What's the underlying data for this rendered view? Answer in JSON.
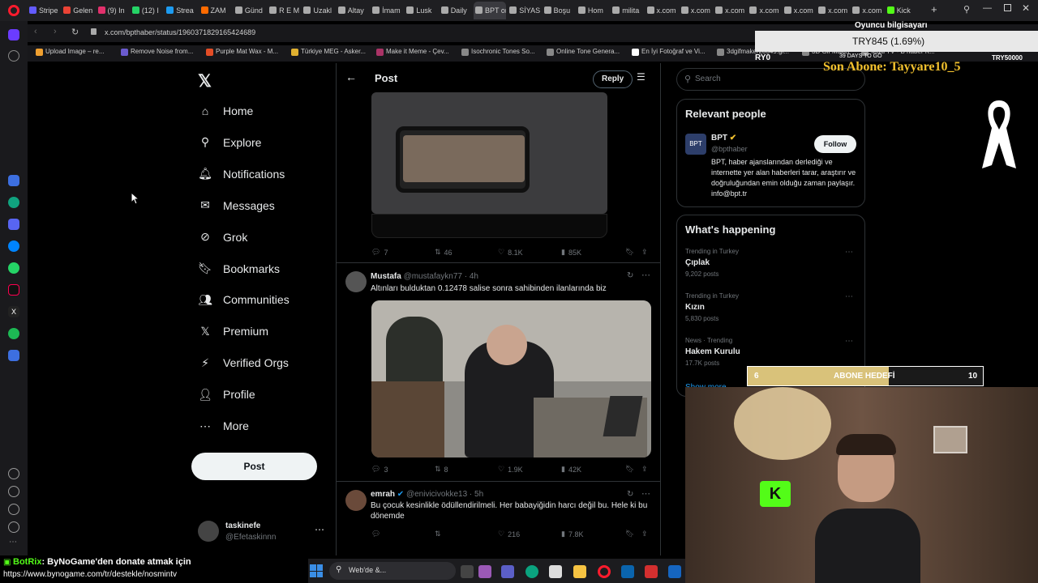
{
  "tabs": [
    {
      "label": "Stripe",
      "color": "#635bff"
    },
    {
      "label": "Gelen",
      "color": "#ea4335"
    },
    {
      "label": "(9) In",
      "color": "#e1306c"
    },
    {
      "label": "(12) I",
      "color": "#25d366"
    },
    {
      "label": "Strea",
      "color": "#1d9bf0"
    },
    {
      "label": "ZAM",
      "color": "#ff6b00"
    },
    {
      "label": "Günd",
      "color": "#aaaaaa"
    },
    {
      "label": "R E M",
      "color": "#aaaaaa"
    },
    {
      "label": "Uzakl",
      "color": "#aaaaaa"
    },
    {
      "label": "Altay",
      "color": "#aaaaaa"
    },
    {
      "label": "İmam",
      "color": "#aaaaaa"
    },
    {
      "label": "Lusk",
      "color": "#aaaaaa"
    },
    {
      "label": "Daily",
      "color": "#aaaaaa"
    },
    {
      "label": "BPT on X",
      "color": "#aaaaaa",
      "active": true
    },
    {
      "label": "SİYAS",
      "color": "#aaaaaa"
    },
    {
      "label": "Boşu",
      "color": "#aaaaaa"
    },
    {
      "label": "Hom",
      "color": "#aaaaaa"
    },
    {
      "label": "milita",
      "color": "#aaaaaa"
    },
    {
      "label": "x.com",
      "color": "#aaaaaa"
    },
    {
      "label": "x.com",
      "color": "#aaaaaa"
    },
    {
      "label": "x.com",
      "color": "#aaaaaa"
    },
    {
      "label": "x.com",
      "color": "#aaaaaa"
    },
    {
      "label": "x.com",
      "color": "#aaaaaa"
    },
    {
      "label": "x.com",
      "color": "#aaaaaa"
    },
    {
      "label": "x.com",
      "color": "#aaaaaa"
    },
    {
      "label": "Kick",
      "color": "#53fc18"
    }
  ],
  "address": {
    "url": "x.com/bpthaber/status/1960371829165424689"
  },
  "bookmarks": [
    {
      "label": "Upload Image – re...",
      "color": "#f0a030"
    },
    {
      "label": "Remove Noise from...",
      "color": "#6a5acd"
    },
    {
      "label": "Purple Mat Wax - M...",
      "color": "#e44d26"
    },
    {
      "label": "Türkiye MEG - Asker...",
      "color": "#e0b030"
    },
    {
      "label": "Make it Meme - Çev...",
      "color": "#aa3366"
    },
    {
      "label": "Isochronic Tones So...",
      "color": "#888888"
    },
    {
      "label": "Online Tone Genera...",
      "color": "#888888"
    },
    {
      "label": "En İyi Fotoğraf ve Vi...",
      "color": "#ffffff"
    },
    {
      "label": "3dgifmaker28349.gi...",
      "color": "#888888"
    },
    {
      "label": "3D Gif Maker",
      "color": "#888888"
    },
    {
      "label": "Multi TV - B haber K...",
      "color": "#888888"
    }
  ],
  "nav": [
    {
      "label": "Home",
      "icon": "home-icon",
      "glyph": "⌂"
    },
    {
      "label": "Explore",
      "icon": "search-icon",
      "glyph": "⚲"
    },
    {
      "label": "Notifications",
      "icon": "bell-icon",
      "glyph": "🔔︎"
    },
    {
      "label": "Messages",
      "icon": "mail-icon",
      "glyph": "✉"
    },
    {
      "label": "Grok",
      "icon": "grok-icon",
      "glyph": "⊘"
    },
    {
      "label": "Bookmarks",
      "icon": "bookmark-icon",
      "glyph": "🔖︎"
    },
    {
      "label": "Communities",
      "icon": "communities-icon",
      "glyph": "👥︎"
    },
    {
      "label": "Premium",
      "icon": "x-logo-icon",
      "glyph": "𝕏"
    },
    {
      "label": "Verified Orgs",
      "icon": "lightning-icon",
      "glyph": "⚡︎"
    },
    {
      "label": "Profile",
      "icon": "person-icon",
      "glyph": "👤︎"
    },
    {
      "label": "More",
      "icon": "more-circle-icon",
      "glyph": "⋯"
    }
  ],
  "post_button": "Post",
  "account": {
    "name": "taskinefe",
    "handle": "@Efetaskinnn"
  },
  "header": {
    "title": "Post",
    "reply": "Reply"
  },
  "tweet_top_stats": {
    "replies": "7",
    "retweets": "46",
    "likes": "8.1K",
    "views": "85K"
  },
  "tweets": [
    {
      "name": "Mustafa",
      "handle": "@mustafaykn77 · 4h",
      "text": "Altınları bulduktan 0.12478 salise sonra sahibinden ilanlarında biz",
      "replies": "3",
      "retweets": "8",
      "likes": "1.9K",
      "views": "42K"
    },
    {
      "name": "emrah",
      "handle": "@enivicivokke13 · 5h",
      "text": "Bu çocuk kesinlikle ödüllendirilmeli. Her babayiğidin harcı değil bu. Hele ki bu dönemde",
      "replies": "",
      "retweets": "",
      "likes": "216",
      "views": "7.8K"
    }
  ],
  "search": {
    "placeholder": "Search"
  },
  "relevant": {
    "title": "Relevant people",
    "name": "BPT",
    "handle": "@bpthaber",
    "follow": "Follow",
    "bio": "BPT, haber ajanslarından derlediği ve internette yer alan haberleri tarar, araştırır ve doğruluğundan emin olduğu zaman paylaşır. info@bpt.tr"
  },
  "happening": {
    "title": "What's happening",
    "trends": [
      {
        "meta": "Trending in Turkey",
        "name": "Çıplak",
        "count": "9,202 posts"
      },
      {
        "meta": "Trending in Turkey",
        "name": "Kızın",
        "count": "5,830 posts"
      },
      {
        "meta": "News · Trending",
        "name": "Hakem Kurulu",
        "count": "17.7K posts"
      }
    ],
    "show_more": "Show more"
  },
  "overlay": {
    "pc": "Oyuncu bilgisayarı",
    "price": "TRY845 (1.69%)",
    "left": "RY0",
    "days": "39 DAYS TO GO",
    "right": "TRY50000",
    "abone": "Son Abone: Tayyare10_5",
    "goal_label": "ABONE HEDEFİ",
    "goal_cur": "6",
    "goal_max": "10",
    "goal_fraction": 0.6
  },
  "chat": {
    "user": "BotRix",
    "msg": ": ByNoGame'den donate atmak için",
    "link": "https://www.bynogame.com/tr/destekle/nosmintv"
  },
  "taskbar": {
    "search": "Web'de &..."
  },
  "colors": {
    "accent": "#1d9bf0",
    "gold": "#f2c12e",
    "kick": "#53fc18"
  }
}
